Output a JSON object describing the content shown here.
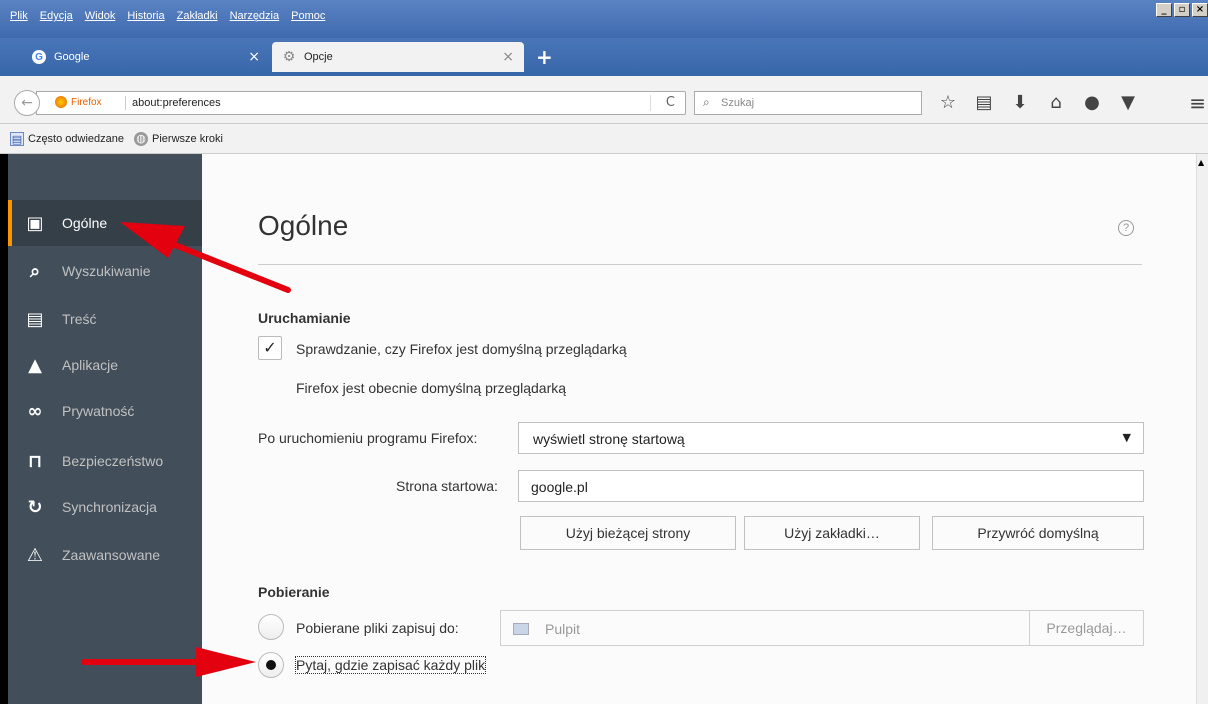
{
  "menubar": {
    "items": [
      "Plik",
      "Edycja",
      "Widok",
      "Historia",
      "Zakładki",
      "Narzędzia",
      "Pomoc"
    ],
    "window_controls": [
      "_",
      "▫",
      "×"
    ]
  },
  "tabs": [
    {
      "label": "Google",
      "favicon": "google-icon",
      "close": "×"
    },
    {
      "label": "Opcje",
      "favicon": "gear-icon",
      "close": "×"
    }
  ],
  "newtab": "+",
  "navbar": {
    "back": "←",
    "identity_label": "Firefox",
    "url": "about:preferences",
    "reload": "C",
    "search_placeholder": "Szukaj",
    "icons": [
      "star-icon",
      "library-icon",
      "download-icon",
      "home-icon",
      "chat-icon",
      "pocket-icon"
    ],
    "icon_glyphs": [
      "☆",
      "▤",
      "⬇",
      "⌂",
      "●",
      "▼"
    ],
    "menu": "≡"
  },
  "bookmarks": [
    {
      "label": "Często odwiedzane",
      "icon": "bookmark-folder-icon"
    },
    {
      "label": "Pierwsze kroki",
      "icon": "globe-icon"
    }
  ],
  "sidebar": {
    "items": [
      {
        "label": "Ogólne",
        "icon": "general-icon",
        "glyph": "▣",
        "active": true
      },
      {
        "label": "Wyszukiwanie",
        "icon": "search-icon",
        "glyph": "🔍︎",
        "active": false
      },
      {
        "label": "Treść",
        "icon": "content-icon",
        "glyph": "▤",
        "active": false
      },
      {
        "label": "Aplikacje",
        "icon": "applications-icon",
        "glyph": "▲",
        "active": false
      },
      {
        "label": "Prywatność",
        "icon": "privacy-mask-icon",
        "glyph": "∞",
        "active": false
      },
      {
        "label": "Bezpieczeństwo",
        "icon": "security-icon",
        "glyph": "⊓",
        "active": false
      },
      {
        "label": "Synchronizacja",
        "icon": "sync-icon",
        "glyph": "↻",
        "active": false
      },
      {
        "label": "Zaawansowane",
        "icon": "advanced-icon",
        "glyph": "⚠",
        "active": false
      }
    ]
  },
  "main": {
    "title": "Ogólne",
    "help": "?",
    "startup": {
      "heading": "Uruchamianie",
      "default_check_label": "Sprawdzanie, czy Firefox jest domyślną przeglądarką",
      "default_checked": true,
      "note": "Firefox jest obecnie domyślną przeglądarką",
      "on_start_label": "Po uruchomieniu programu Firefox:",
      "on_start_value": "wyświetl stronę startową",
      "homepage_label": "Strona startowa:",
      "homepage_value": "google.pl",
      "buttons": [
        "Użyj bieżącej strony",
        "Użyj zakładki…",
        "Przywróć domyślną"
      ]
    },
    "downloads": {
      "heading": "Pobieranie",
      "save_to_label": "Pobierane pliki zapisuj do:",
      "folder_value": "Pulpit",
      "browse": "Przeglądaj…",
      "ask_label": "Pytaj, gdzie zapisać każdy plik",
      "selected": "ask"
    }
  },
  "colors": {
    "sidebar_bg": "#424f5a",
    "sidebar_active_bg": "#343f48",
    "accent": "#ff9500",
    "annotation_arrow": "#e3000f"
  }
}
